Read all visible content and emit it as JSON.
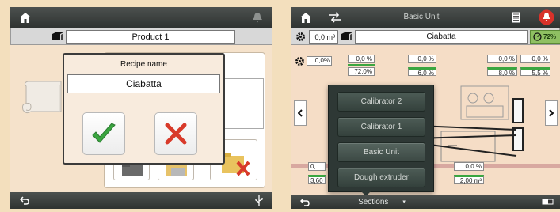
{
  "left": {
    "product_title": "Product 1",
    "dialog_title": "Recipe name",
    "recipe_value": "Ciabatta"
  },
  "right": {
    "header_title": "Basic Unit",
    "volume": "0,0 m³",
    "product": "Ciabatta",
    "level_pct": "72%",
    "readings": {
      "r_left": "0,0%",
      "r1_top": "0,0 %",
      "r1_bottom": "72,0%",
      "r2_top": "0,0 %",
      "r2_bottom": "6,0 %",
      "r3_top": "0,0 %",
      "r3_bottom": "8,0 %",
      "r4_top": "0,0 %",
      "r4_bottom": "5,5 %",
      "low_left_top": "0,",
      "low_left_bottom": "3,60",
      "low_right_top": "0,0 %",
      "low_right_bottom": "2,00 m³"
    },
    "sections_menu": [
      "Calibrator 2",
      "Calibrator 1",
      "Basic Unit",
      "Dough extruder"
    ],
    "sections_label": "Sections"
  },
  "colors": {
    "accent_green": "#3aa640",
    "accent_red": "#d83a2a",
    "warning_red": "#d8322a"
  }
}
